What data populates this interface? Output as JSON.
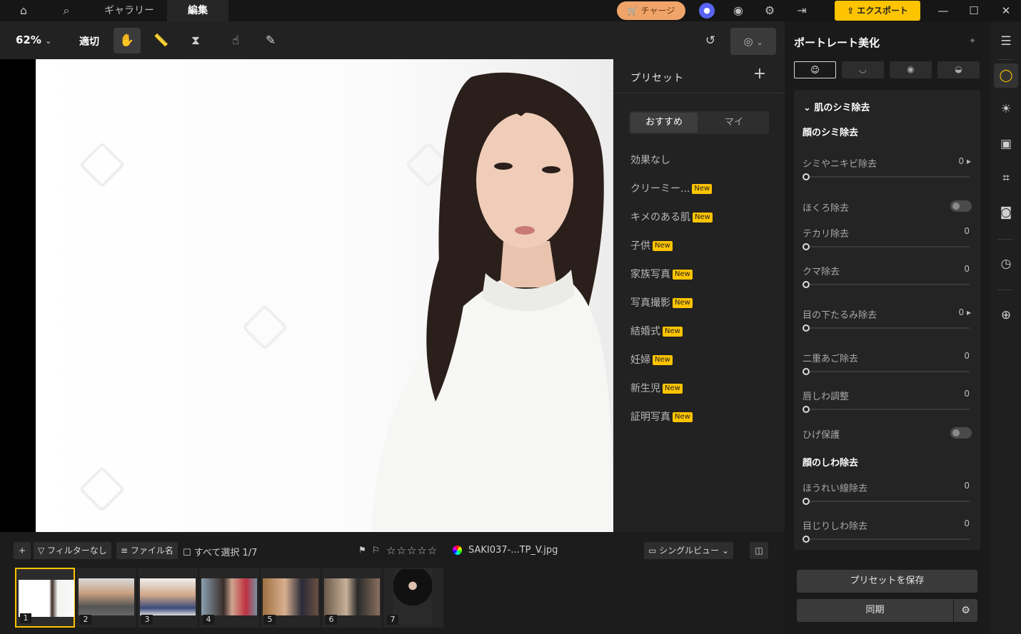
{
  "topbar": {
    "tabs": [
      "ギャラリー",
      "編集"
    ],
    "charge_label": "チャージ",
    "export_label": "エクスポート"
  },
  "toolbar": {
    "zoom": "62%",
    "fit_label": "適切"
  },
  "preset_panel": {
    "title": "プリセット",
    "tabs": [
      "おすすめ",
      "マイ"
    ],
    "items": [
      {
        "label": "効果なし",
        "badge": ""
      },
      {
        "label": "クリーミー...",
        "badge": "New"
      },
      {
        "label": "キメのある肌",
        "badge": "New"
      },
      {
        "label": "子供",
        "badge": "New"
      },
      {
        "label": "家族写真",
        "badge": "New"
      },
      {
        "label": "写真撮影",
        "badge": "New"
      },
      {
        "label": "結婚式",
        "badge": "New"
      },
      {
        "label": "妊婦",
        "badge": "New"
      },
      {
        "label": "新生児",
        "badge": "New"
      },
      {
        "label": "証明写真",
        "badge": "New"
      }
    ]
  },
  "right_panel": {
    "title": "ポートレート美化",
    "section": "肌のシミ除去",
    "group1": "顔のシミ除去",
    "group2": "顔のしわ除去",
    "sliders": [
      {
        "label": "シミやニキビ除去",
        "value": "0"
      },
      {
        "label": "ほくろ除去"
      },
      {
        "label": "テカリ除去",
        "value": "0"
      },
      {
        "label": "クマ除去",
        "value": "0"
      },
      {
        "label": "目の下たるみ除去",
        "value": "0"
      },
      {
        "label": "二重あご除去",
        "value": "0"
      },
      {
        "label": "唇しわ調整",
        "value": "0"
      },
      {
        "label": "ひげ保護"
      },
      {
        "label": "ほうれい線除去",
        "value": "0"
      },
      {
        "label": "目じりしわ除去",
        "value": "0"
      }
    ],
    "save_preset_label": "プリセットを保存",
    "sync_label": "同期"
  },
  "filmstrip": {
    "filter_label": "フィルターなし",
    "sort_label": "ファイル名",
    "select_all_label": "すべて選択 1/7",
    "filename": "SAKI037-...TP_V.jpg",
    "view_label": "シングルビュー",
    "thumbs": [
      "1",
      "2",
      "3",
      "4",
      "5",
      "6",
      "7"
    ]
  }
}
